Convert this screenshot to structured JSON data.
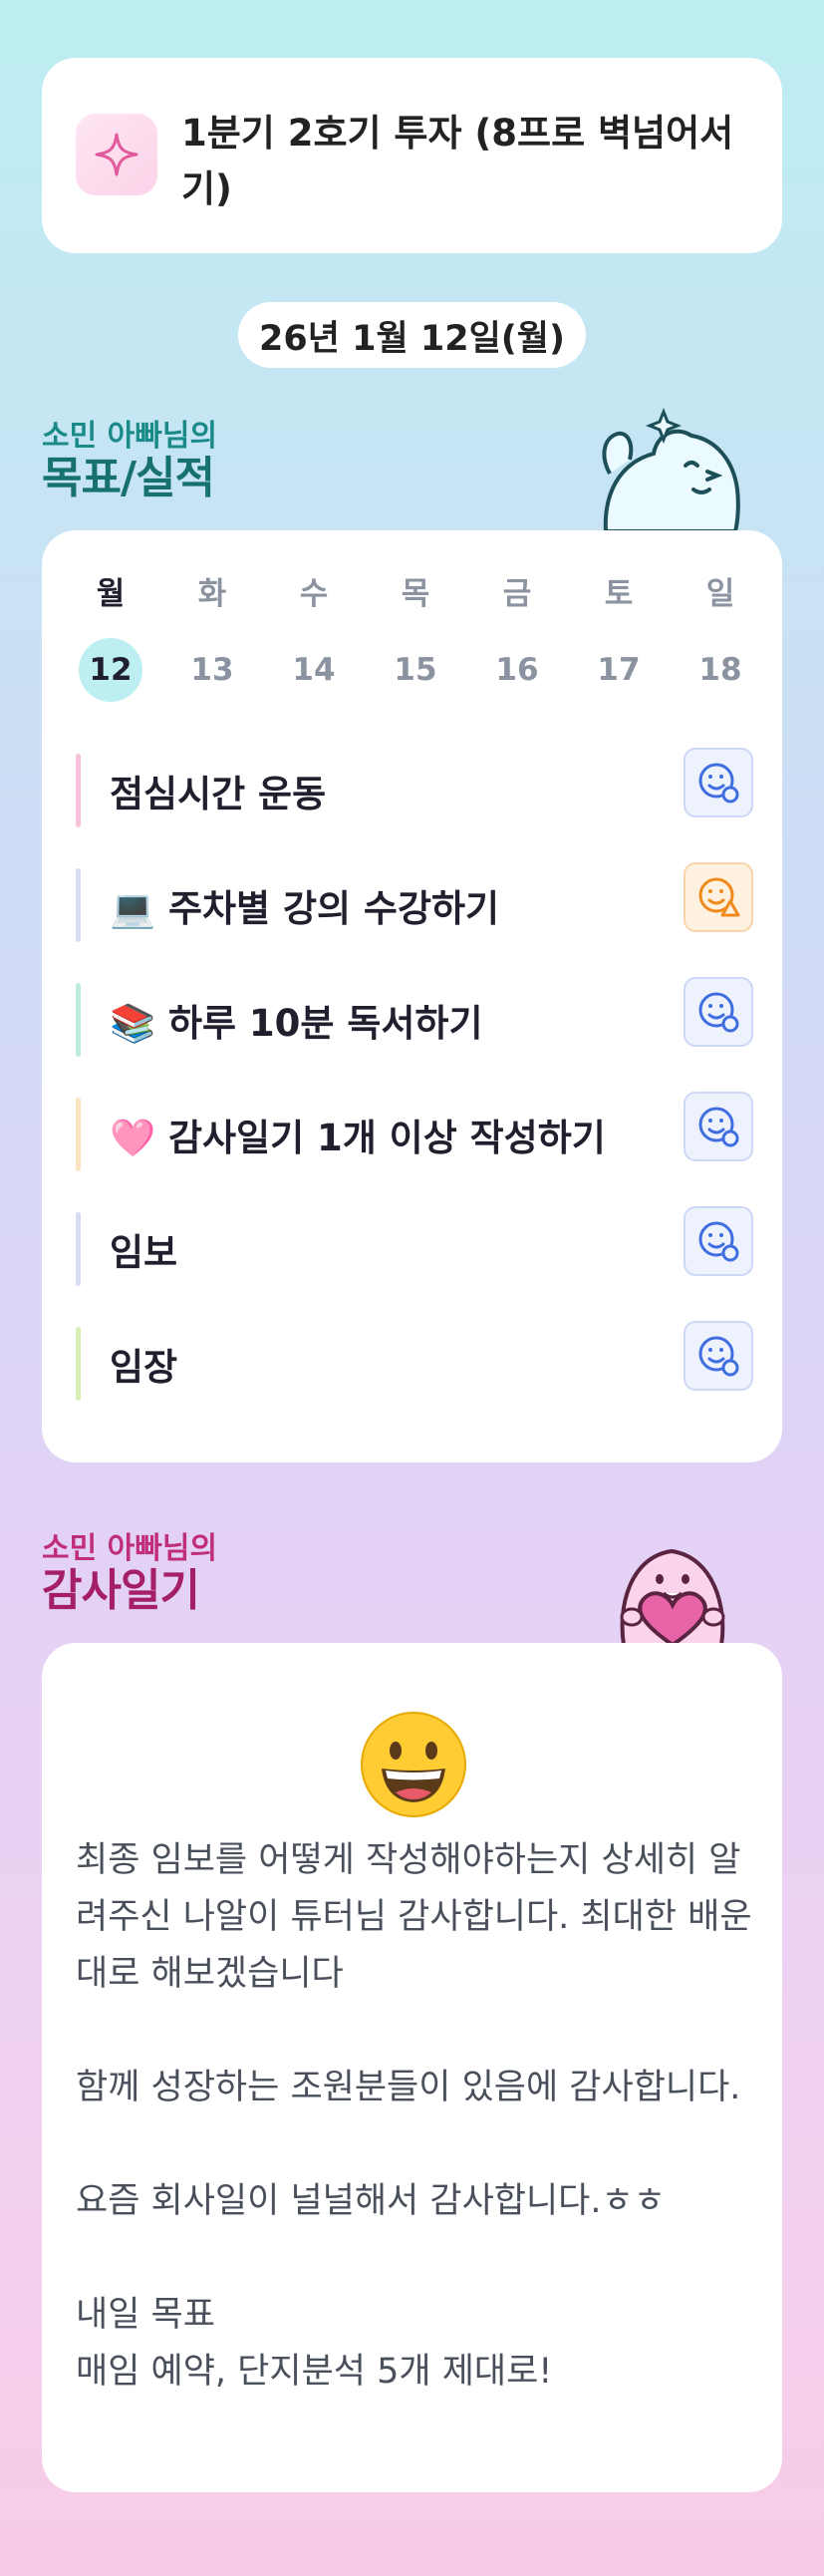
{
  "goal": {
    "title": "1분기 2호기 투자 (8프로 벽넘어서기)",
    "icon": "sparkle-icon"
  },
  "date": "26년 1월 12일(월)",
  "goals_section": {
    "subtitle": "소민 아빠님의",
    "title": "목표/실적"
  },
  "week": [
    {
      "day": "월",
      "date": "12",
      "active": true
    },
    {
      "day": "화",
      "date": "13",
      "active": false
    },
    {
      "day": "수",
      "date": "14",
      "active": false
    },
    {
      "day": "목",
      "date": "15",
      "active": false
    },
    {
      "day": "금",
      "date": "16",
      "active": false
    },
    {
      "day": "토",
      "date": "17",
      "active": false
    },
    {
      "day": "일",
      "date": "18",
      "active": false
    }
  ],
  "tasks": [
    {
      "label": "점심시간 운동",
      "bar_color": "#f6c1d9",
      "status": "blue",
      "icon": "smile-status-icon"
    },
    {
      "label": "💻 주차별 강의 수강하기",
      "bar_color": "#d6ddf5",
      "status": "orange",
      "icon": "smile-warning-icon"
    },
    {
      "label": "📚 하루 10분 독서하기",
      "bar_color": "#bfecd8",
      "status": "blue",
      "icon": "smile-status-icon"
    },
    {
      "label": "🩷 감사일기 1개 이상 작성하기",
      "bar_color": "#fbe3c2",
      "status": "blue",
      "icon": "smile-status-icon"
    },
    {
      "label": "임보",
      "bar_color": "#d6ddf5",
      "status": "blue",
      "icon": "smile-status-icon"
    },
    {
      "label": "임장",
      "bar_color": "#d7efb6",
      "status": "blue",
      "icon": "smile-status-icon"
    }
  ],
  "diary_section": {
    "subtitle": "소민 아빠님의",
    "title": "감사일기"
  },
  "diary": {
    "emoji": "😀",
    "text": "최종 임보를 어떻게 작성해야하는지 상세히 알려주신 나알이 튜터님 감사합니다. 최대한 배운대로 해보겠습니다\n\n함께 성장하는 조원분들이 있음에 감사합니다.\n\n요즘 회사일이 널널해서 감사합니다.ㅎㅎ\n\n내일 목표\n매임 예약, 단지분석 5개 제대로!"
  },
  "colors": {
    "teal": "#1a8a88",
    "pink": "#c02e7a",
    "active_date_bg": "#bdeef1"
  }
}
